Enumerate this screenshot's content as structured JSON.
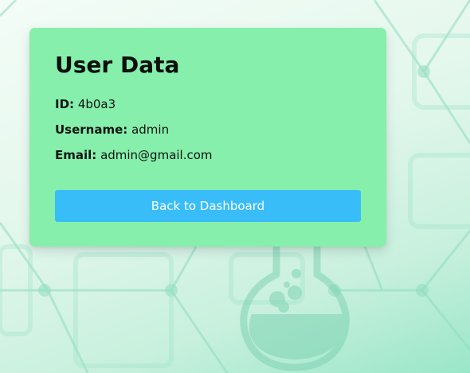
{
  "user_card": {
    "title": "User Data",
    "id_label": "ID:",
    "id_value": "4b0a3",
    "username_label": "Username:",
    "username_value": "admin",
    "email_label": "Email:",
    "email_value": "admin@gmail.com",
    "back_button_label": "Back to Dashboard"
  },
  "background": {
    "illustration": "flask-icon",
    "pattern": "hexagon-network"
  },
  "colors": {
    "card_background": "#86efac",
    "button_background": "#38bdf8",
    "button_text": "#ffffff",
    "page_gradient_start": "#f4fcf7",
    "page_gradient_end": "#9ae6c8"
  }
}
